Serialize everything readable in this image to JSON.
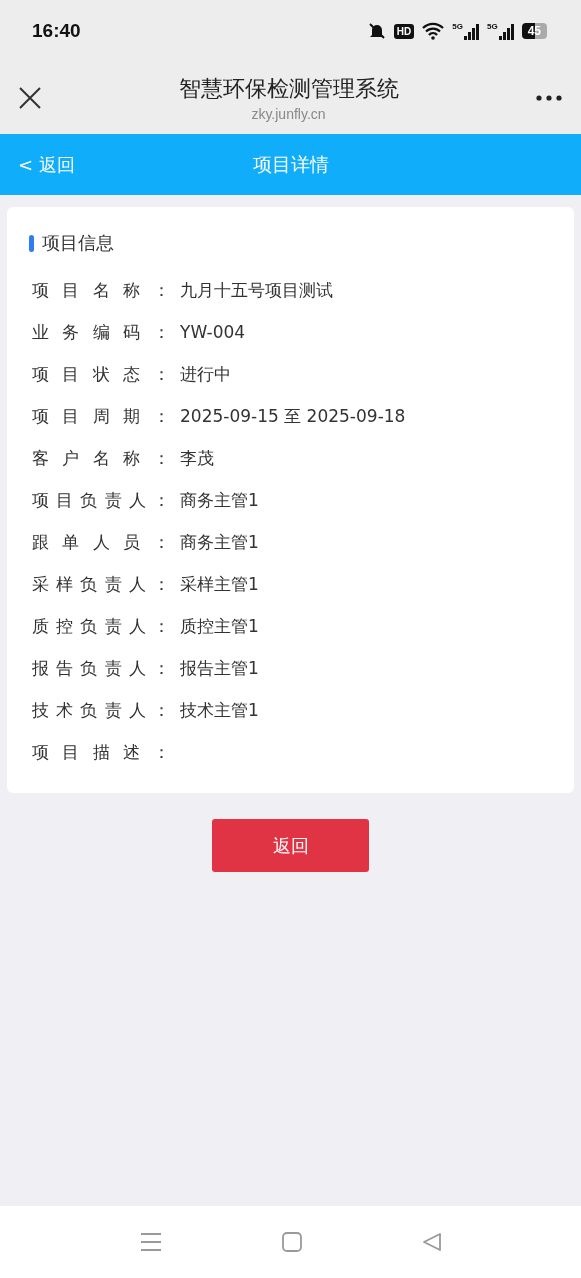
{
  "status_bar": {
    "time": "16:40",
    "hd_badge": "HD",
    "network_labels": [
      "5G",
      "5G"
    ],
    "battery": "45"
  },
  "browser": {
    "title": "智慧环保检测管理系统",
    "url": "zky.junfly.cn"
  },
  "nav": {
    "back": "< 返回",
    "title": "项目详情"
  },
  "card": {
    "title": "项目信息",
    "fields": [
      {
        "label": "项目名称：",
        "value": "九月十五号项目测试"
      },
      {
        "label": "业务编码：",
        "value": "YW-004"
      },
      {
        "label": "项目状态：",
        "value": "进行中"
      },
      {
        "label": "项目周期：",
        "value": "2025-09-15 至 2025-09-18"
      },
      {
        "label": "客户名称：",
        "value": "李茂"
      },
      {
        "label": "项目负责人：",
        "value": "商务主管1"
      },
      {
        "label": "跟单人员：",
        "value": "商务主管1"
      },
      {
        "label": "采样负责人：",
        "value": "采样主管1"
      },
      {
        "label": "质控负责人：",
        "value": "质控主管1"
      },
      {
        "label": "报告负责人：",
        "value": "报告主管1"
      },
      {
        "label": "技术负责人：",
        "value": "技术主管1"
      },
      {
        "label": "项目描述："
      }
    ]
  },
  "button": "返回"
}
